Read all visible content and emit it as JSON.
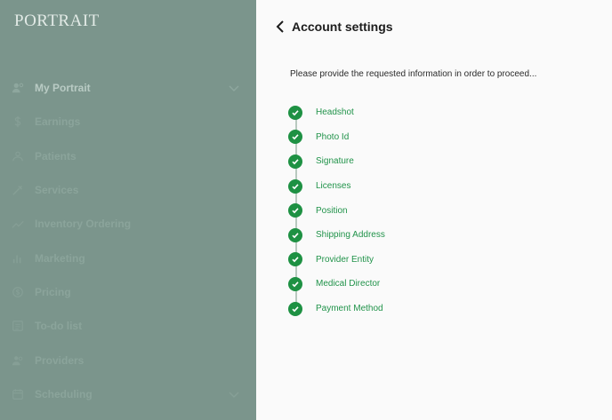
{
  "sidebar": {
    "logo": "PORTRAIT",
    "items": [
      {
        "label": "My Portrait",
        "icon": "user-gear-icon",
        "active": true,
        "chevron": true
      },
      {
        "label": "Earnings",
        "icon": "dollar-icon"
      },
      {
        "label": "Patients",
        "icon": "patients-icon"
      },
      {
        "label": "Services",
        "icon": "syringe-icon"
      },
      {
        "label": "Inventory Ordering",
        "icon": "trend-icon"
      },
      {
        "label": "Marketing",
        "icon": "bar-chart-icon"
      },
      {
        "label": "Pricing",
        "icon": "pricing-icon"
      },
      {
        "label": "To-do list",
        "icon": "checklist-icon"
      },
      {
        "label": "Providers",
        "icon": "users-icon"
      },
      {
        "label": "Scheduling",
        "icon": "calendar-icon",
        "chevron": true
      }
    ]
  },
  "main": {
    "title": "Account settings",
    "intro": "Please provide the requested information in order to proceed...",
    "steps": [
      {
        "label": "Headshot",
        "completed": true
      },
      {
        "label": "Photo Id",
        "completed": true
      },
      {
        "label": "Signature",
        "completed": true
      },
      {
        "label": "Licenses",
        "completed": true
      },
      {
        "label": "Position",
        "completed": true
      },
      {
        "label": "Shipping Address",
        "completed": true
      },
      {
        "label": "Provider Entity",
        "completed": true
      },
      {
        "label": "Medical Director",
        "completed": true
      },
      {
        "label": "Payment Method",
        "completed": true
      }
    ]
  },
  "colors": {
    "sidebar_bg": "#7b958c",
    "step_green": "#1e9143"
  }
}
